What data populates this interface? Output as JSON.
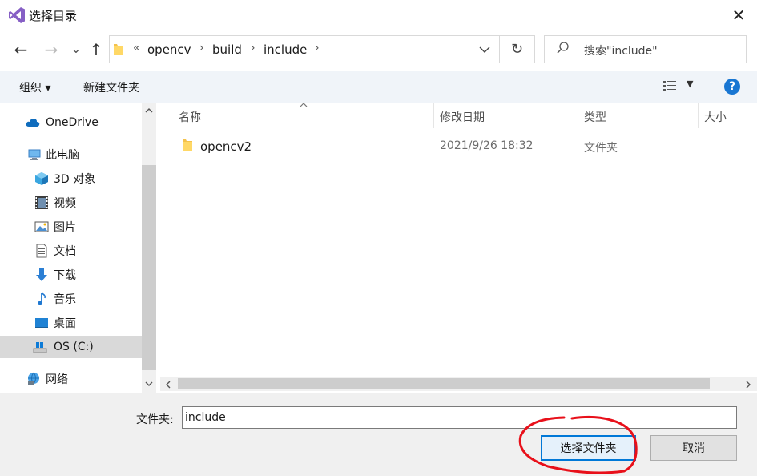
{
  "window": {
    "title": "选择目录",
    "close_glyph": "✕"
  },
  "nav": {
    "back_glyph": "←",
    "forward_glyph": "→",
    "recent_glyph": "⌄",
    "up_glyph": "↑",
    "path_prefix": "«",
    "breadcrumbs": [
      "opencv",
      "build",
      "include"
    ],
    "crumb_sep": "›",
    "refresh_glyph": "↻",
    "search_placeholder": "搜索\"include\""
  },
  "toolbar": {
    "organize": "组织 ▾",
    "new_folder": "新建文件夹",
    "view_drop": "▼",
    "help": "?"
  },
  "sidebar": {
    "items": [
      {
        "label": "OneDrive",
        "icon": "cloud-icon"
      },
      {
        "label": "此电脑",
        "icon": "computer-icon"
      },
      {
        "label": "3D 对象",
        "icon": "cube-icon"
      },
      {
        "label": "视频",
        "icon": "video-icon"
      },
      {
        "label": "图片",
        "icon": "picture-icon"
      },
      {
        "label": "文档",
        "icon": "document-icon"
      },
      {
        "label": "下载",
        "icon": "download-icon"
      },
      {
        "label": "音乐",
        "icon": "music-icon"
      },
      {
        "label": "桌面",
        "icon": "desktop-icon"
      },
      {
        "label": "OS (C:)",
        "icon": "drive-icon"
      },
      {
        "label": "网络",
        "icon": "network-icon"
      }
    ],
    "selected": "OS (C:)"
  },
  "table": {
    "columns": [
      "名称",
      "修改日期",
      "类型",
      "大小"
    ],
    "rows": [
      {
        "name": "opencv2",
        "modified": "2021/9/26 18:32",
        "type": "文件夹",
        "size": ""
      }
    ]
  },
  "footer": {
    "filename_label": "文件夹:",
    "filename_value": "include",
    "select_button": "选择文件夹",
    "cancel_button": "取消"
  },
  "colors": {
    "accent": "#0078d7",
    "annotation": "#e8101a",
    "selected_bg": "#d9d9d9"
  }
}
